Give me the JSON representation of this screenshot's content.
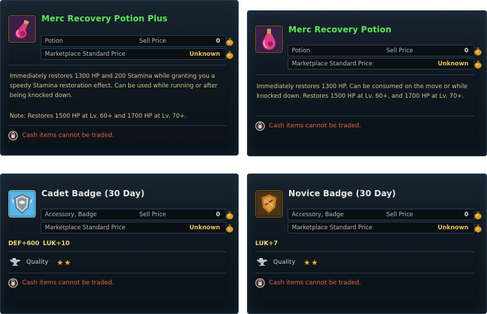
{
  "tooltips": [
    {
      "name": "Merc Recovery Potion Plus",
      "icon": "pink-potion-icon",
      "type": "Potion",
      "sell_label": "Sell Price",
      "sell_value": "0",
      "market_label": "Marketplace Standard Price",
      "market_value": "Unknown",
      "description": "Immediately restores 1300 HP and 200 Stamina while granting you a speedy Stamina restoration effect. Can be used while running or after being knocked down.",
      "note": "Note: Restores 1500 HP at Lv. 60+ and 1700 HP at Lv. 70+.",
      "cash_notice": "Cash items cannot be traded."
    },
    {
      "name": "Merc Recovery Potion",
      "icon": "pink-potion-icon",
      "type": "Potion",
      "sell_label": "Sell Price",
      "sell_value": "0",
      "market_label": "Marketplace Standard Price",
      "market_value": "Unknown",
      "description": "Immediately restores 1300 HP. Can be consumed on the move or while knocked down. Restores 1500 HP at Lv. 60+, and 1700 HP at Lv. 70+.",
      "cash_notice": "Cash items cannot be traded."
    },
    {
      "name": "Cadet Badge (30 Day)",
      "icon": "silver-badge-icon",
      "type": "Accessory, Badge",
      "sell_label": "Sell Price",
      "sell_value": "0",
      "market_label": "Marketplace Standard Price",
      "market_value": "Unknown",
      "stats": "DEF+600  LUK+10",
      "quality_label": "Quality",
      "quality_stars": "★★",
      "cash_notice": "Cash items cannot be traded."
    },
    {
      "name": "Novice Badge (30 Day)",
      "icon": "bronze-badge-icon",
      "type": "Accessory, Badge",
      "sell_label": "Sell Price",
      "sell_value": "0",
      "market_label": "Marketplace Standard Price",
      "market_value": "Unknown",
      "stats": "LUK+7",
      "quality_label": "Quality",
      "quality_stars": "★★",
      "cash_notice": "Cash items cannot be traded."
    }
  ],
  "colors": {
    "name_green": "#5fe35a",
    "description_gold": "#d8c08a",
    "warning_red": "#e46440",
    "stars_gold": "#f0b020"
  }
}
